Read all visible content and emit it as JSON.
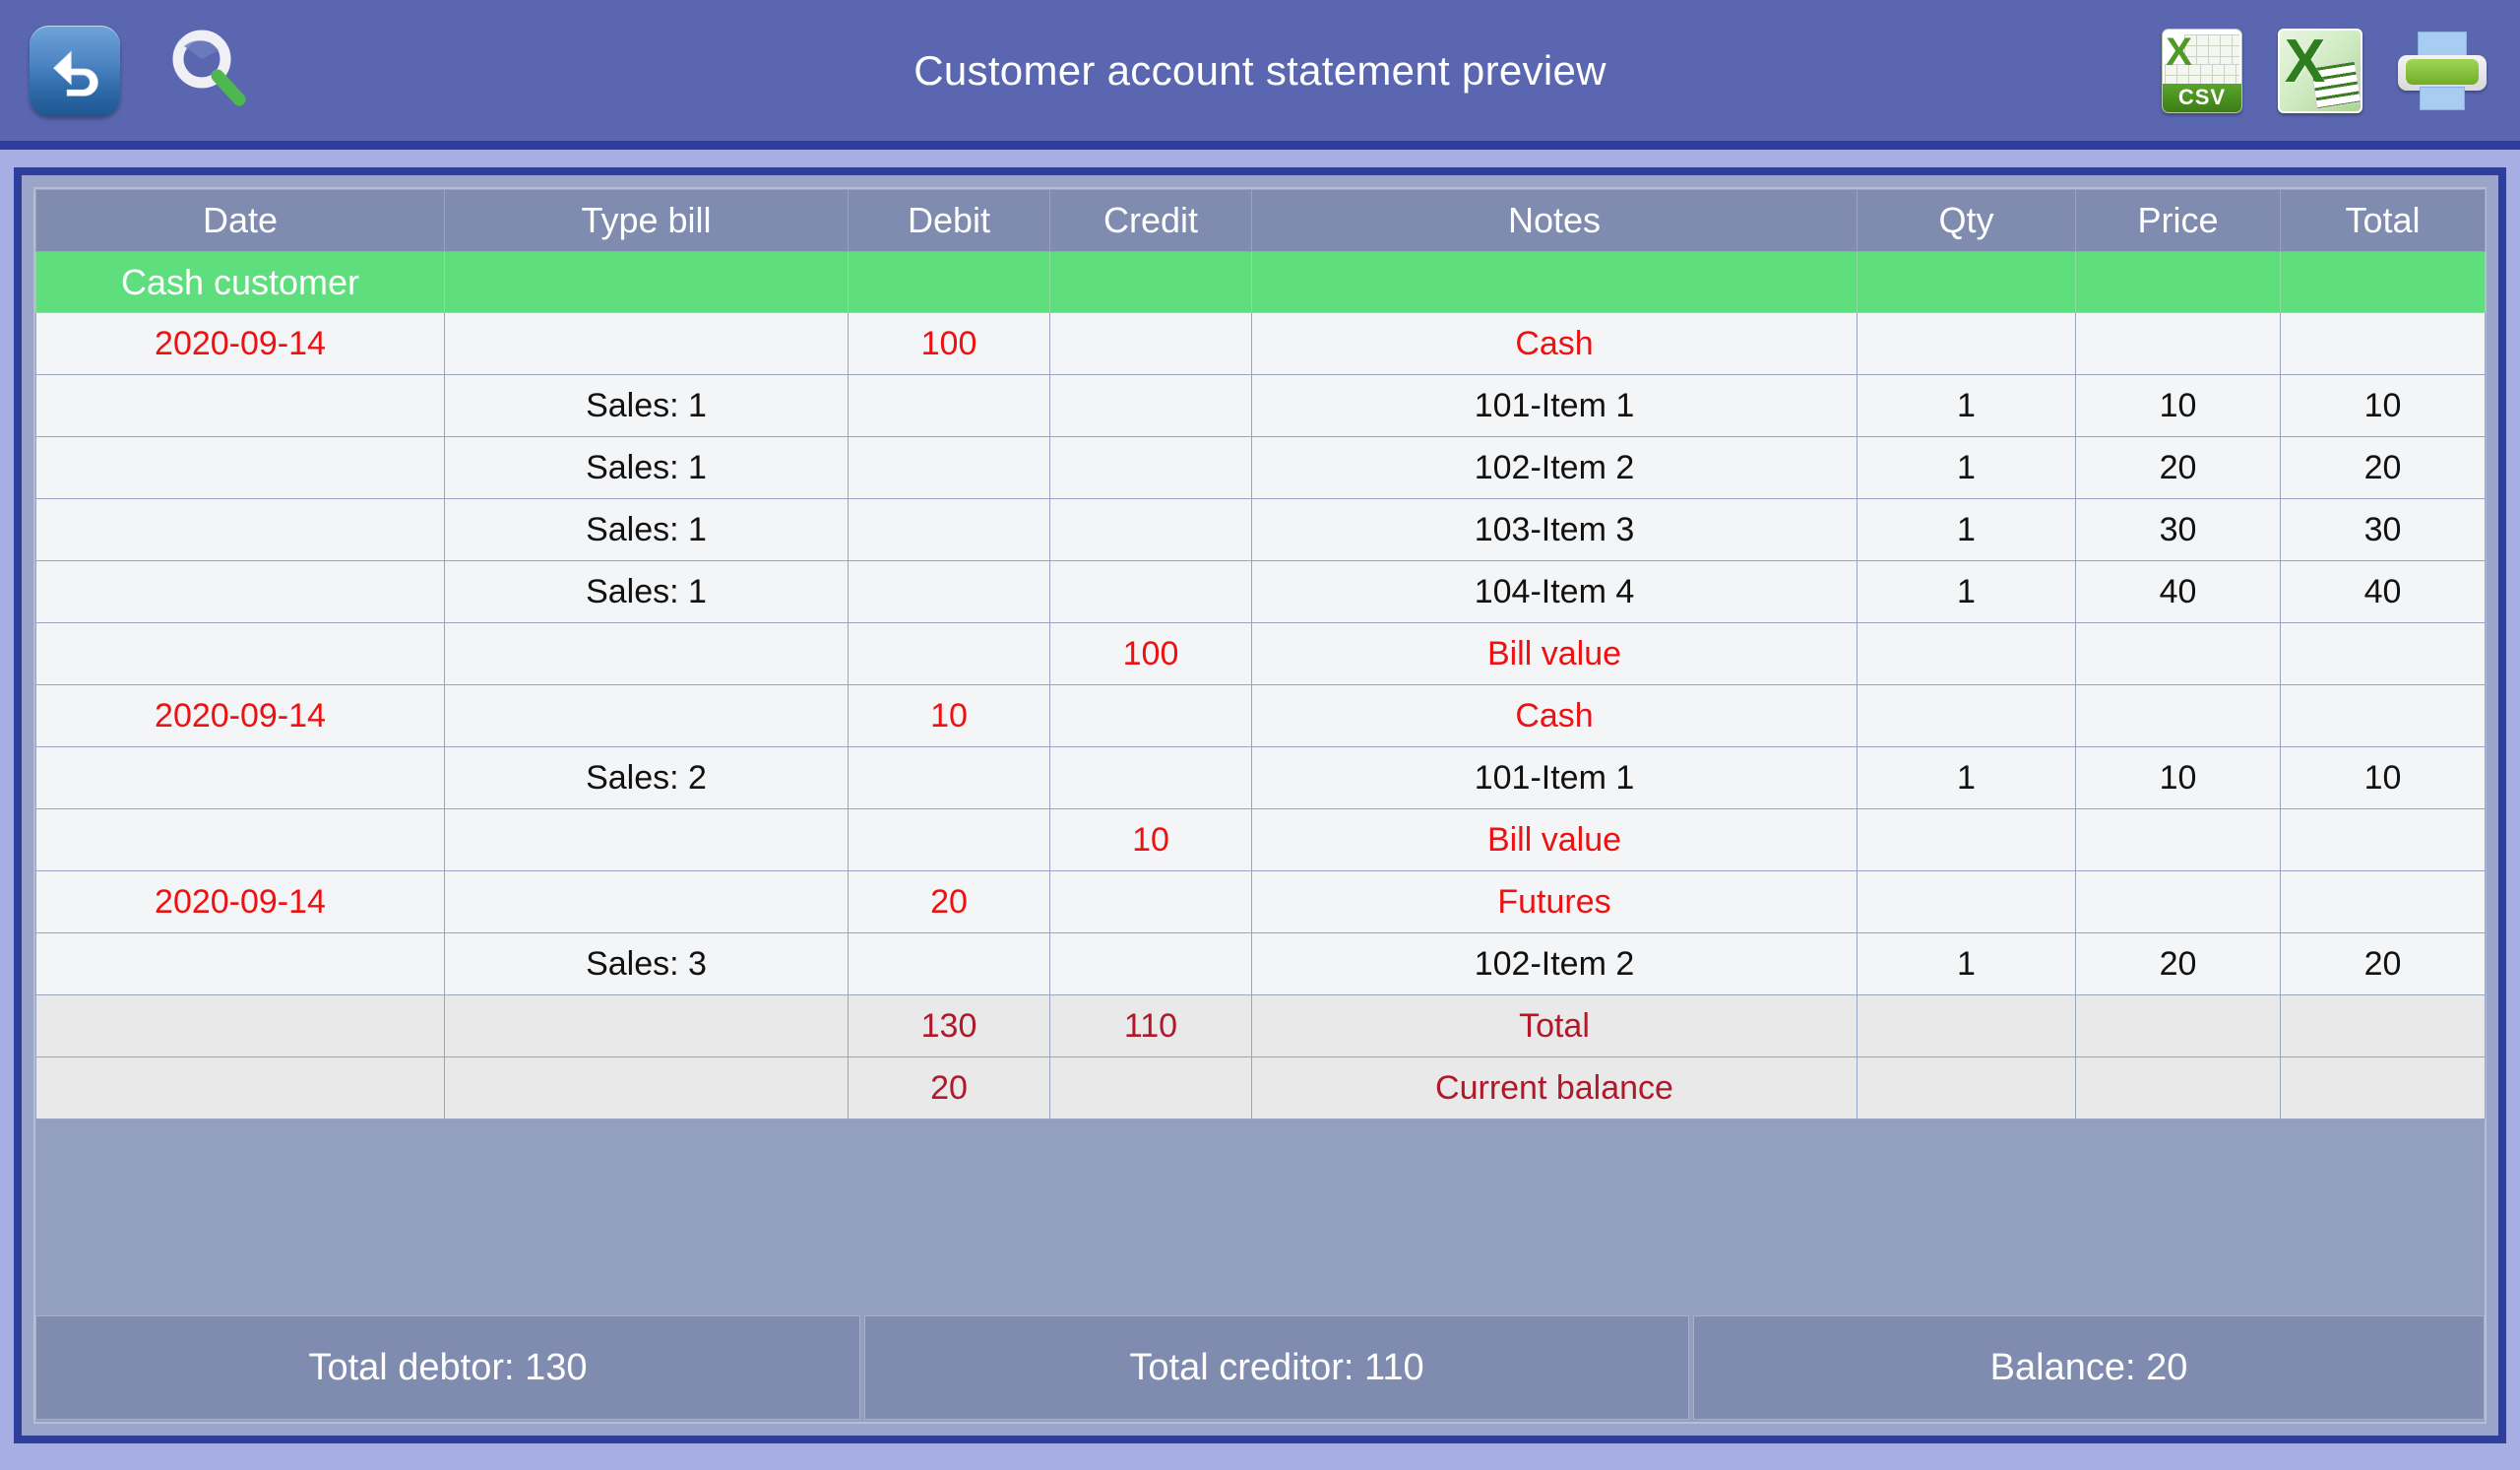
{
  "header": {
    "title": "Customer account statement preview",
    "back_icon": "back-arrow-icon",
    "search_icon": "magnifier-icon",
    "csv_icon_label": "CSV",
    "csv_icon_x": "X",
    "excel_icon_x": "X",
    "printer_icon": "printer-icon"
  },
  "colors": {
    "topbar": "#5a67b0",
    "frame_border": "#2e3e9c",
    "panel": "#939fbe",
    "table_header": "#7f8cb0",
    "group_row": "#5fde7e",
    "accent_red": "#ee1111",
    "summary_red": "#b0192a",
    "row_bg": "#f4f5f7",
    "summary_bg": "#e9e9e9"
  },
  "table": {
    "columns": [
      "Date",
      "Type bill",
      "Debit",
      "Credit",
      "Notes",
      "Qty",
      "Price",
      "Total"
    ],
    "group_label": "Cash customer",
    "rows": [
      {
        "style": "group",
        "cells": [
          "Cash customer",
          "",
          "",
          "",
          "",
          "",
          "",
          ""
        ]
      },
      {
        "style": "normal",
        "cells": [
          "2020-09-14",
          "",
          "100",
          "",
          "Cash",
          "",
          "",
          ""
        ],
        "red": [
          0,
          2,
          4
        ]
      },
      {
        "style": "normal",
        "cells": [
          "",
          "Sales: 1",
          "",
          "",
          "101-Item 1",
          "1",
          "10",
          "10"
        ],
        "red": []
      },
      {
        "style": "normal",
        "cells": [
          "",
          "Sales: 1",
          "",
          "",
          "102-Item 2",
          "1",
          "20",
          "20"
        ],
        "red": []
      },
      {
        "style": "normal",
        "cells": [
          "",
          "Sales: 1",
          "",
          "",
          "103-Item 3",
          "1",
          "30",
          "30"
        ],
        "red": []
      },
      {
        "style": "normal",
        "cells": [
          "",
          "Sales: 1",
          "",
          "",
          "104-Item 4",
          "1",
          "40",
          "40"
        ],
        "red": []
      },
      {
        "style": "normal",
        "cells": [
          "",
          "",
          "",
          "100",
          "Bill value",
          "",
          "",
          ""
        ],
        "red": [
          3,
          4
        ]
      },
      {
        "style": "normal",
        "cells": [
          "2020-09-14",
          "",
          "10",
          "",
          "Cash",
          "",
          "",
          ""
        ],
        "red": [
          0,
          2,
          4
        ]
      },
      {
        "style": "normal",
        "cells": [
          "",
          "Sales: 2",
          "",
          "",
          "101-Item 1",
          "1",
          "10",
          "10"
        ],
        "red": []
      },
      {
        "style": "normal",
        "cells": [
          "",
          "",
          "",
          "10",
          "Bill value",
          "",
          "",
          ""
        ],
        "red": [
          3,
          4
        ]
      },
      {
        "style": "normal",
        "cells": [
          "2020-09-14",
          "",
          "20",
          "",
          "Futures",
          "",
          "",
          ""
        ],
        "red": [
          0,
          2,
          4
        ]
      },
      {
        "style": "normal",
        "cells": [
          "",
          "Sales: 3",
          "",
          "",
          "102-Item 2",
          "1",
          "20",
          "20"
        ],
        "red": []
      },
      {
        "style": "sum",
        "cells": [
          "",
          "",
          "130",
          "110",
          "Total",
          "",
          "",
          ""
        ],
        "red": []
      },
      {
        "style": "sum",
        "cells": [
          "",
          "",
          "20",
          "",
          "Current balance",
          "",
          "",
          ""
        ],
        "red": []
      }
    ]
  },
  "footer": {
    "total_debtor": "Total debtor: 130",
    "total_creditor": "Total creditor: 110",
    "balance": "Balance: 20"
  }
}
